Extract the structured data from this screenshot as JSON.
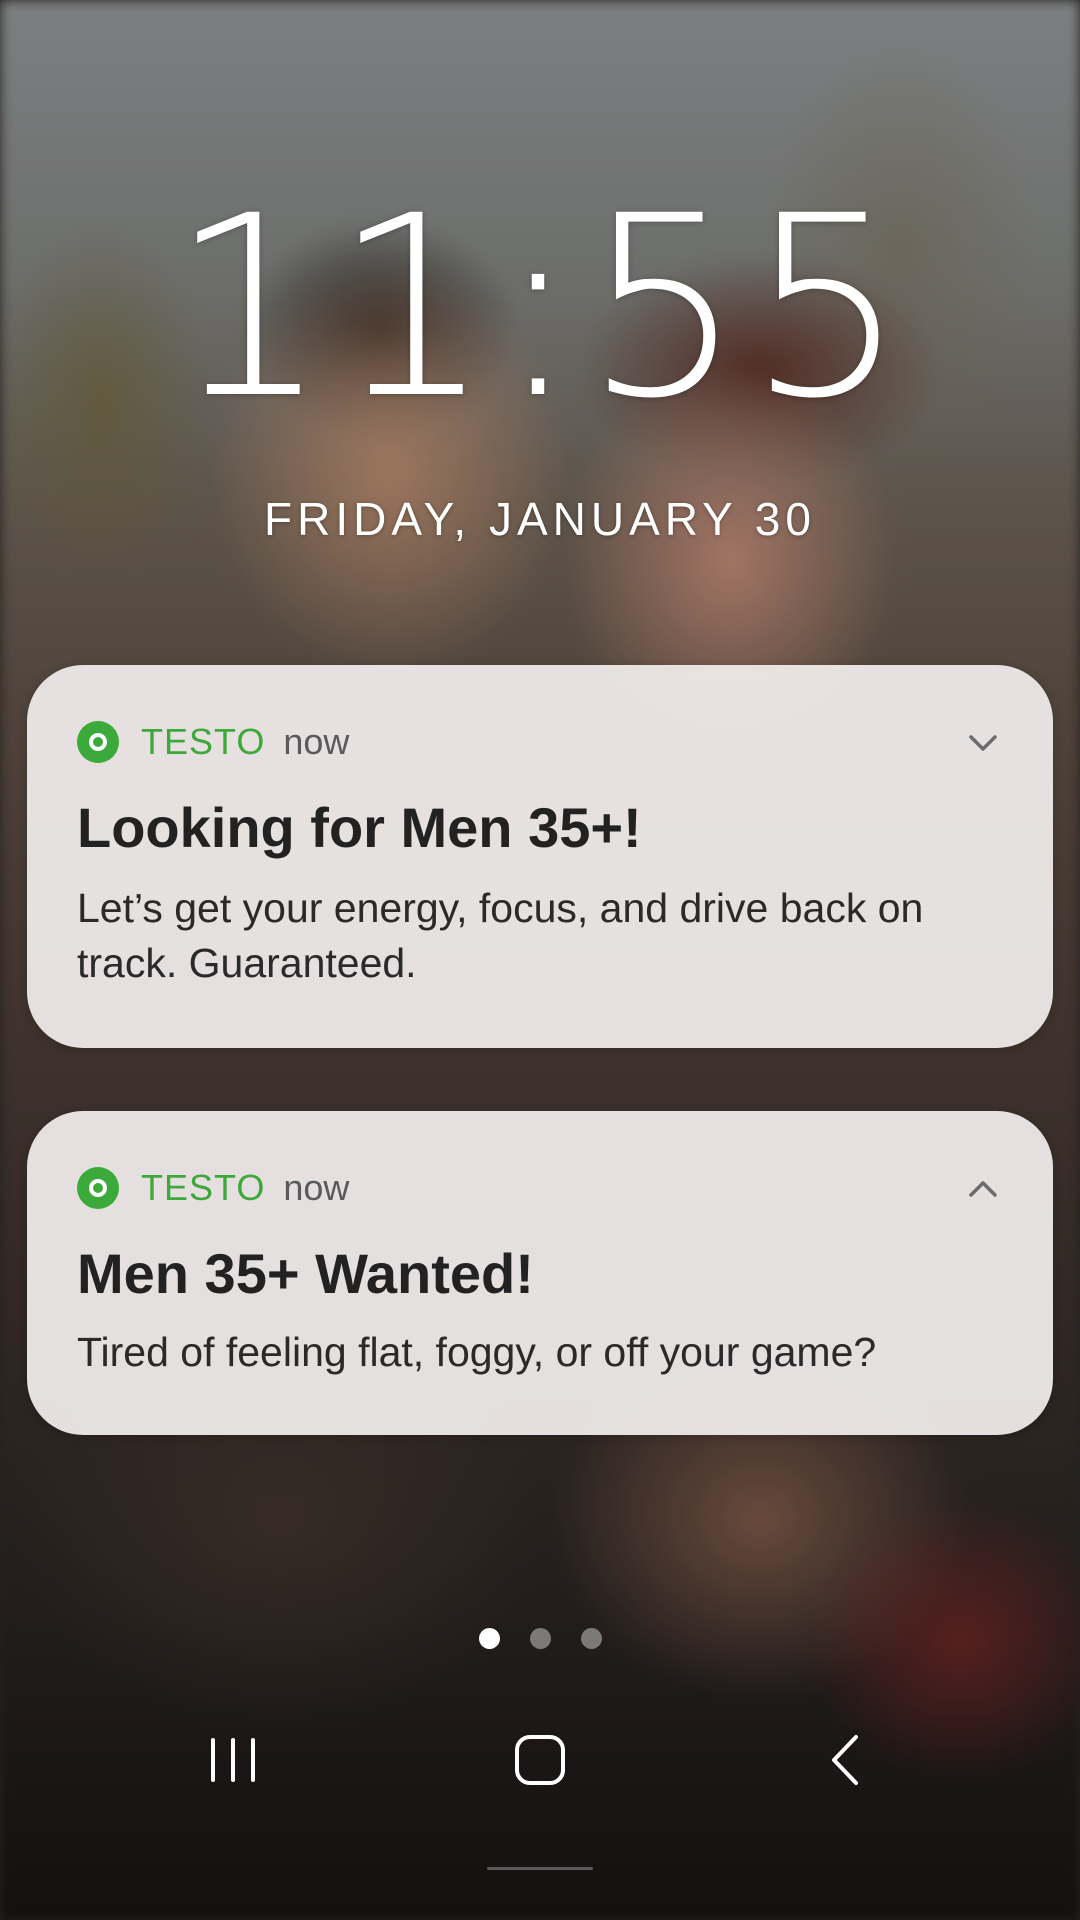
{
  "lockscreen": {
    "time": "11:55",
    "date": "FRIDAY, JANUARY 30"
  },
  "notifications": [
    {
      "app_name": "TESTO",
      "time": "now",
      "title": "Looking for Men 35+!",
      "body": "Let’s get your energy, focus, and drive back on track. Guaranteed.",
      "expand_icon": "chevron-down-icon"
    },
    {
      "app_name": "TESTO",
      "time": "now",
      "title": "Men 35+ Wanted!",
      "body": "Tired of feeling flat, foggy, or off your game?",
      "expand_icon": "chevron-up-icon"
    }
  ],
  "page_indicator": {
    "count": 3,
    "active_index": 0
  },
  "navigation": {
    "recents_icon": "recents-icon",
    "home_icon": "home-icon",
    "back_icon": "back-icon"
  },
  "colors": {
    "app_accent": "#3fa83a",
    "card_background": "#eeeae9",
    "title_text": "#222222"
  }
}
